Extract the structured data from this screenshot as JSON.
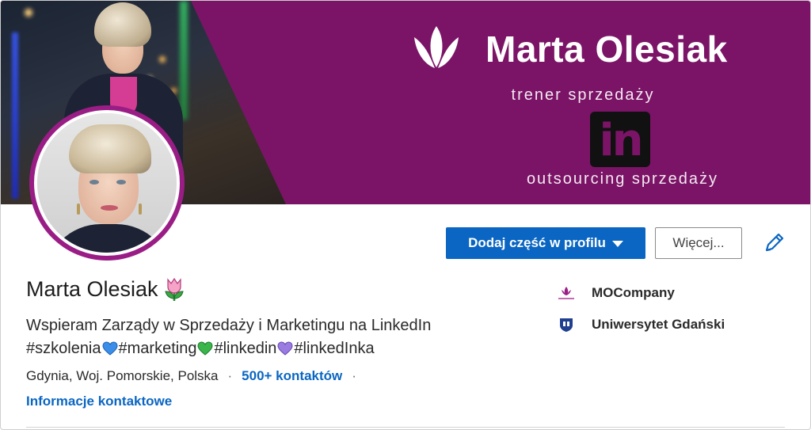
{
  "banner": {
    "brand_name": "Marta Olesiak",
    "tagline_top": "trener sprzedaży",
    "logo_text": "in",
    "tagline_bottom": "outsourcing sprzedaży"
  },
  "actions": {
    "add_section_label": "Dodaj część w profilu",
    "more_label": "Więcej...",
    "edit_icon": "pencil-icon"
  },
  "profile": {
    "name": "Marta Olesiak",
    "headline_line1": "Wspieram Zarządy w Sprzedaży i Marketingu na LinkedIn",
    "hashtags": [
      "#szkolenia",
      "#marketing",
      "#linkedin",
      "#linkedInka"
    ],
    "location": "Gdynia, Woj. Pomorskie, Polska",
    "connections": "500+ kontaktów",
    "contact_info": "Informacje kontaktowe"
  },
  "organizations": [
    {
      "name": "MOCompany",
      "logo": "mocompany-logo"
    },
    {
      "name": "Uniwersytet Gdański",
      "logo": "university-logo"
    }
  ],
  "colors": {
    "banner_bg": "#7b1467",
    "primary_blue": "#0a66c2",
    "avatar_ring": "#9a1d86",
    "heart_blue": "#3b8ee8",
    "heart_green": "#39b54a",
    "heart_purple": "#9a7be0"
  }
}
